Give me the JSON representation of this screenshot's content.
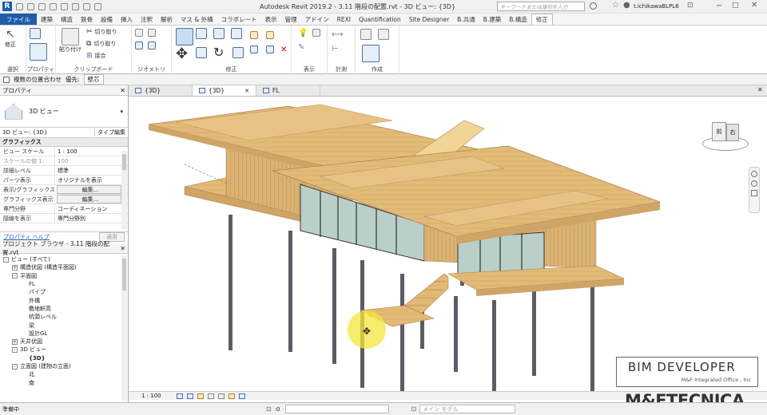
{
  "titlebar": {
    "title": "Autodesk Revit 2019.2 - 3.11 階段の配置.rvt - 3D ビュー: {3D}",
    "search_placeholder": "キーワードまたは語句を入力",
    "user": "t.ichikawaBLPL6"
  },
  "ribbon_tabs": [
    "ファイル",
    "建築",
    "構造",
    "鉄骨",
    "設備",
    "挿入",
    "注釈",
    "解析",
    "マス & 外構",
    "コラボレート",
    "表示",
    "管理",
    "アドイン",
    "REXI",
    "Quantification",
    "Site Designer",
    "B.共通",
    "B.建築",
    "B.構造",
    "修正"
  ],
  "ribbon": {
    "modify_label": "修正",
    "paste_label": "貼り付け",
    "cut_label": "切り取り",
    "copy_label": "切り取り",
    "join_label": "接合",
    "panels": {
      "select": "選択",
      "properties": "プロパティ",
      "clipboard": "クリップボード",
      "geometry": "ジオメトリ",
      "modify": "修正",
      "view": "表示",
      "measure": "計測",
      "create": "作成"
    }
  },
  "options_bar": {
    "multi_align": "複数の位置合わせ",
    "priority_label": "優先:",
    "priority_value": "壁芯"
  },
  "properties": {
    "header": "プロパティ",
    "type_name": "3D ビュー",
    "selector": "3D ビュー: {3D}",
    "edit_type": "タイプ編集",
    "section": "グラフィックス",
    "rows": [
      {
        "k": "ビュー スケール",
        "v": "1 : 100"
      },
      {
        "k": "スケールの値  1:",
        "v": "100"
      },
      {
        "k": "詳細レベル",
        "v": "標準"
      },
      {
        "k": "パーツ表示",
        "v": "オリジナルを表示"
      },
      {
        "k": "表示/グラフィックス...",
        "v": "編集..."
      },
      {
        "k": "グラフィックス表示オ...",
        "v": "編集..."
      },
      {
        "k": "専門分野",
        "v": "コーディネーション"
      },
      {
        "k": "隠線を表示",
        "v": "専門分野別"
      }
    ],
    "help": "プロパティ ヘルプ",
    "apply": "適用"
  },
  "browser": {
    "header": "プロジェクト ブラウザ - 3.11 階段の配置.rvt",
    "items": [
      {
        "label": "ビュー (すべて)",
        "level": 0,
        "toggle": "-"
      },
      {
        "label": "構造伏図 (構造平面図)",
        "level": 1,
        "toggle": "+"
      },
      {
        "label": "平面図",
        "level": 1,
        "toggle": "-"
      },
      {
        "label": "FL",
        "level": 2,
        "toggle": ""
      },
      {
        "label": "パイプ",
        "level": 2,
        "toggle": ""
      },
      {
        "label": "外構",
        "level": 2,
        "toggle": ""
      },
      {
        "label": "敷地軒高",
        "level": 2,
        "toggle": ""
      },
      {
        "label": "杭頭レベル",
        "level": 2,
        "toggle": ""
      },
      {
        "label": "梁",
        "level": 2,
        "toggle": ""
      },
      {
        "label": "設計GL",
        "level": 2,
        "toggle": ""
      },
      {
        "label": "天井伏図",
        "level": 1,
        "toggle": "+"
      },
      {
        "label": "3D ビュー",
        "level": 1,
        "toggle": "-"
      },
      {
        "label": "{3D}",
        "level": 2,
        "toggle": ""
      },
      {
        "label": "立面図 (建物の立面)",
        "level": 1,
        "toggle": "-"
      },
      {
        "label": "北",
        "level": 2,
        "toggle": ""
      },
      {
        "label": "南",
        "level": 2,
        "toggle": ""
      }
    ]
  },
  "view_tabs": [
    "{3D}",
    "{3D}",
    "FL"
  ],
  "viewcube": {
    "left": "前",
    "right": "右"
  },
  "watermark": {
    "title": "BIM DEVELOPER",
    "subtitle": "M&F Integrated Office , Inc",
    "brand": "M&FTECNICA"
  },
  "view_control": {
    "scale": "1 : 100"
  },
  "status": {
    "text": "準備中",
    "model": "メイン モデル",
    "zero": ":0"
  },
  "colors": {
    "accent": "#1f5da8",
    "wood": "#e0b977",
    "glass": "#b9cfc7",
    "column": "#5b5d63"
  }
}
